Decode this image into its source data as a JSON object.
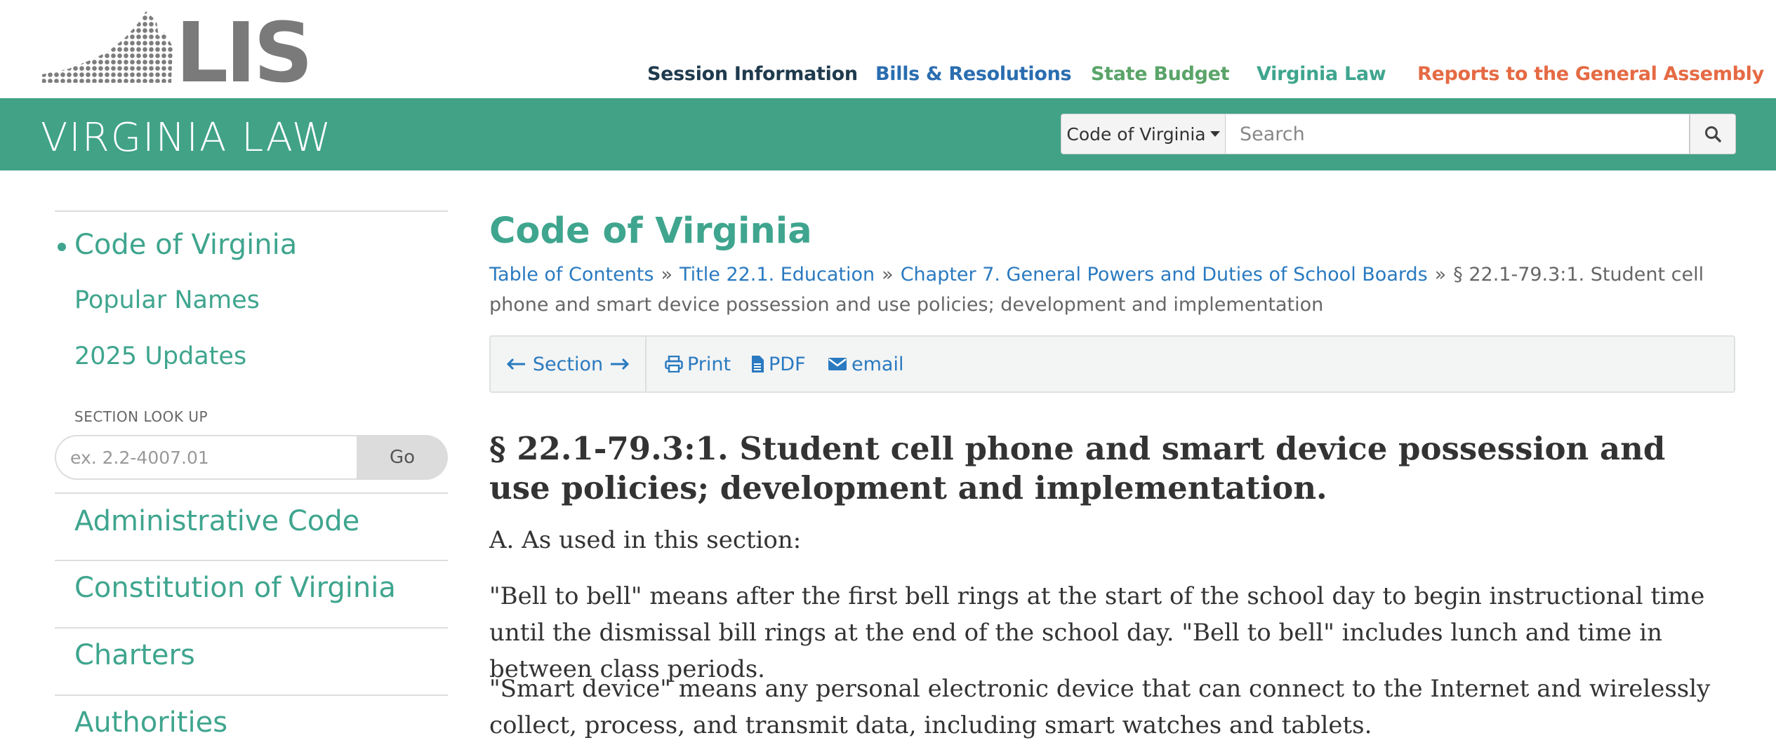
{
  "header": {
    "logo_text": "LIS",
    "nav": {
      "session": "Session Information",
      "bills": "Bills & Resolutions",
      "budget": "State Budget",
      "law": "Virginia Law",
      "reports": "Reports to the General Assembly"
    },
    "colors": {
      "session": "#1f3a4d",
      "bills": "#2a6db0",
      "budget": "#5aa469",
      "law": "#3fa58e",
      "reports": "#e56a44"
    }
  },
  "banner": {
    "title": "VIRGINIA LAW",
    "color": "#41a286",
    "search_scope": "Code of Virginia",
    "search_placeholder": "Search",
    "search_icon": "search-icon"
  },
  "sidebar": {
    "active_item": "Code of Virginia",
    "sub_items": [
      "Popular Names",
      "2025 Updates"
    ],
    "lookup_label": "SECTION LOOK UP",
    "lookup_placeholder": "ex. 2.2-4007.01",
    "lookup_button": "Go",
    "more_items": [
      "Administrative Code",
      "Constitution of Virginia",
      "Charters",
      "Authorities"
    ]
  },
  "main": {
    "page_title": "Code of Virginia",
    "breadcrumbs": [
      "Table of Contents",
      "Title 22.1. Education",
      "Chapter 7. General Powers and Duties of School Boards"
    ],
    "breadcrumb_current": "§ 22.1-79.3:1. Student cell phone and smart device possession and use policies; development and implementation",
    "breadcrumb_separator": "»",
    "toolbar": {
      "section": "Section",
      "print": "Print",
      "pdf": "PDF",
      "email": "email"
    },
    "section_heading": "§ 22.1-79.3:1. Student cell phone and smart device possession and use policies; development and implementation.",
    "paragraphs": [
      "A. As used in this section:",
      "\"Bell to bell\" means after the first bell rings at the start of the school day to begin instructional time until the dismissal bill rings at the end of the school day. \"Bell to bell\" includes lunch and time in between class periods.",
      "\"Smart device\" means any personal electronic device that can connect to the Internet and wirelessly collect, process, and transmit data, including smart watches and tablets."
    ]
  },
  "theme": {
    "accent_green": "#3fa58e",
    "link_blue": "#2a7ac0"
  }
}
